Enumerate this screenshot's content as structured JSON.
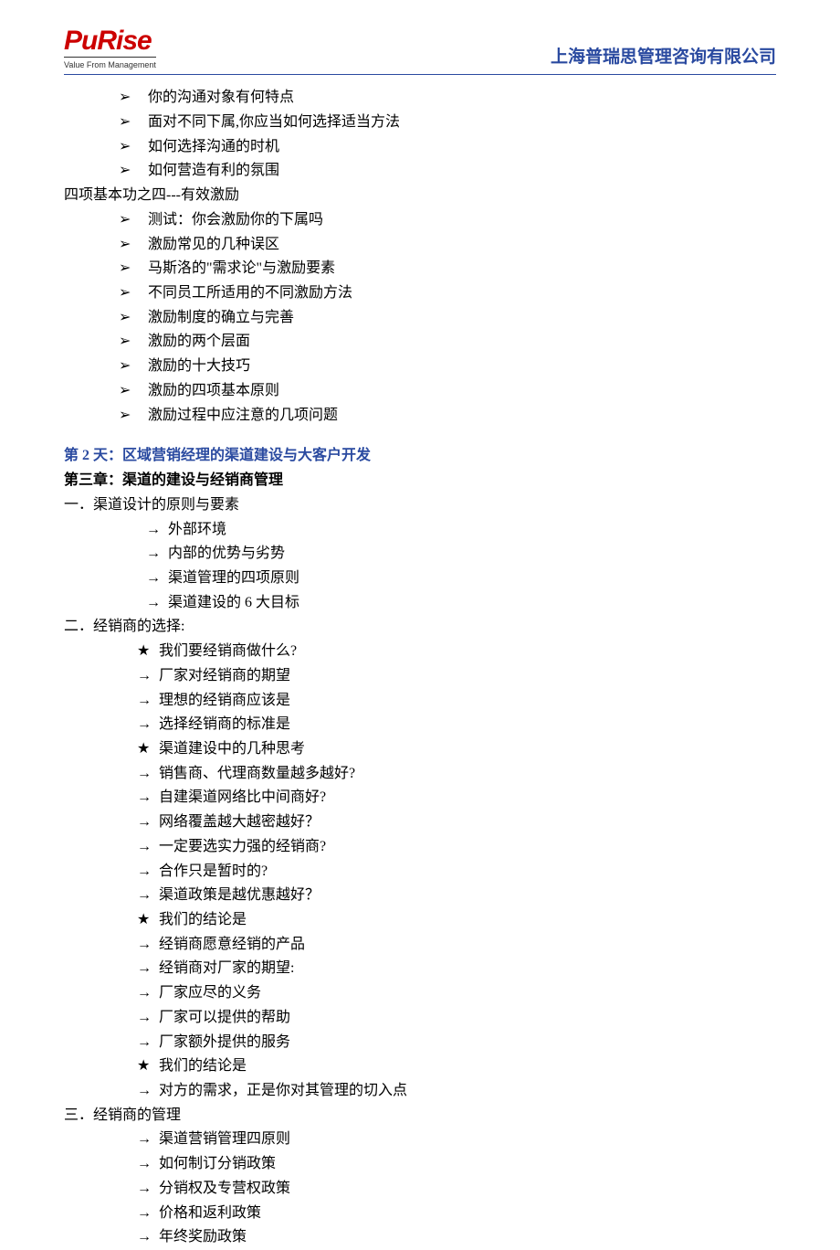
{
  "header": {
    "logo_text": "PuRise",
    "logo_tagline": "Value From Management",
    "company": "上海普瑞思管理咨询有限公司"
  },
  "content": {
    "block1_items": [
      "你的沟通对象有何特点",
      "面对不同下属,你应当如何选择适当方法",
      "如何选择沟通的时机",
      "如何营造有利的氛围"
    ],
    "block1_footer": "四项基本功之四---有效激励",
    "block2_items": [
      "测试：你会激励你的下属吗",
      "激励常见的几种误区",
      "马斯洛的\"需求论\"与激励要素",
      "不同员工所适用的不同激励方法",
      "激励制度的确立与完善",
      "激励的两个层面",
      "激励的十大技巧",
      "激励的四项基本原则",
      "激励过程中应注意的几项问题"
    ],
    "day2_title": "第 2 天：区域营销经理的渠道建设与大客户开发",
    "chapter3_title": "第三章：渠道的建设与经销商管理",
    "section1_title": "一．渠道设计的原则与要素",
    "section1_items": [
      "外部环境",
      "内部的优势与劣势",
      "渠道管理的四项原则",
      "渠道建设的 6 大目标"
    ],
    "section2_title": "二．经销商的选择:",
    "section2_items": [
      {
        "mark": "star",
        "text": "我们要经销商做什么?"
      },
      {
        "mark": "arrow",
        "text": "厂家对经销商的期望"
      },
      {
        "mark": "arrow",
        "text": "理想的经销商应该是"
      },
      {
        "mark": "arrow",
        "text": "选择经销商的标准是"
      },
      {
        "mark": "star",
        "text": "渠道建设中的几种思考"
      },
      {
        "mark": "arrow",
        "text": "销售商、代理商数量越多越好?"
      },
      {
        "mark": "arrow",
        "text": "自建渠道网络比中间商好?"
      },
      {
        "mark": "arrow",
        "text": "网络覆盖越大越密越好？"
      },
      {
        "mark": "arrow",
        "text": "一定要选实力强的经销商?"
      },
      {
        "mark": "arrow",
        "text": "合作只是暂时的?"
      },
      {
        "mark": "arrow",
        "text": "渠道政策是越优惠越好？"
      },
      {
        "mark": "star",
        "text": "我们的结论是"
      },
      {
        "mark": "arrow",
        "text": "经销商愿意经销的产品"
      },
      {
        "mark": "arrow",
        "text": "经销商对厂家的期望:"
      },
      {
        "mark": "arrow",
        "text": "厂家应尽的义务"
      },
      {
        "mark": "arrow",
        "text": "厂家可以提供的帮助"
      },
      {
        "mark": "arrow",
        "text": "厂家额外提供的服务"
      },
      {
        "mark": "star",
        "text": "我们的结论是"
      },
      {
        "mark": "arrow",
        "text": "对方的需求，正是你对其管理的切入点"
      }
    ],
    "section3_title": "三．经销商的管理",
    "section3_items": [
      "渠道营销管理四原则",
      "如何制订分销政策",
      "分销权及专营权政策",
      "价格和返利政策",
      "年终奖励政策"
    ]
  }
}
